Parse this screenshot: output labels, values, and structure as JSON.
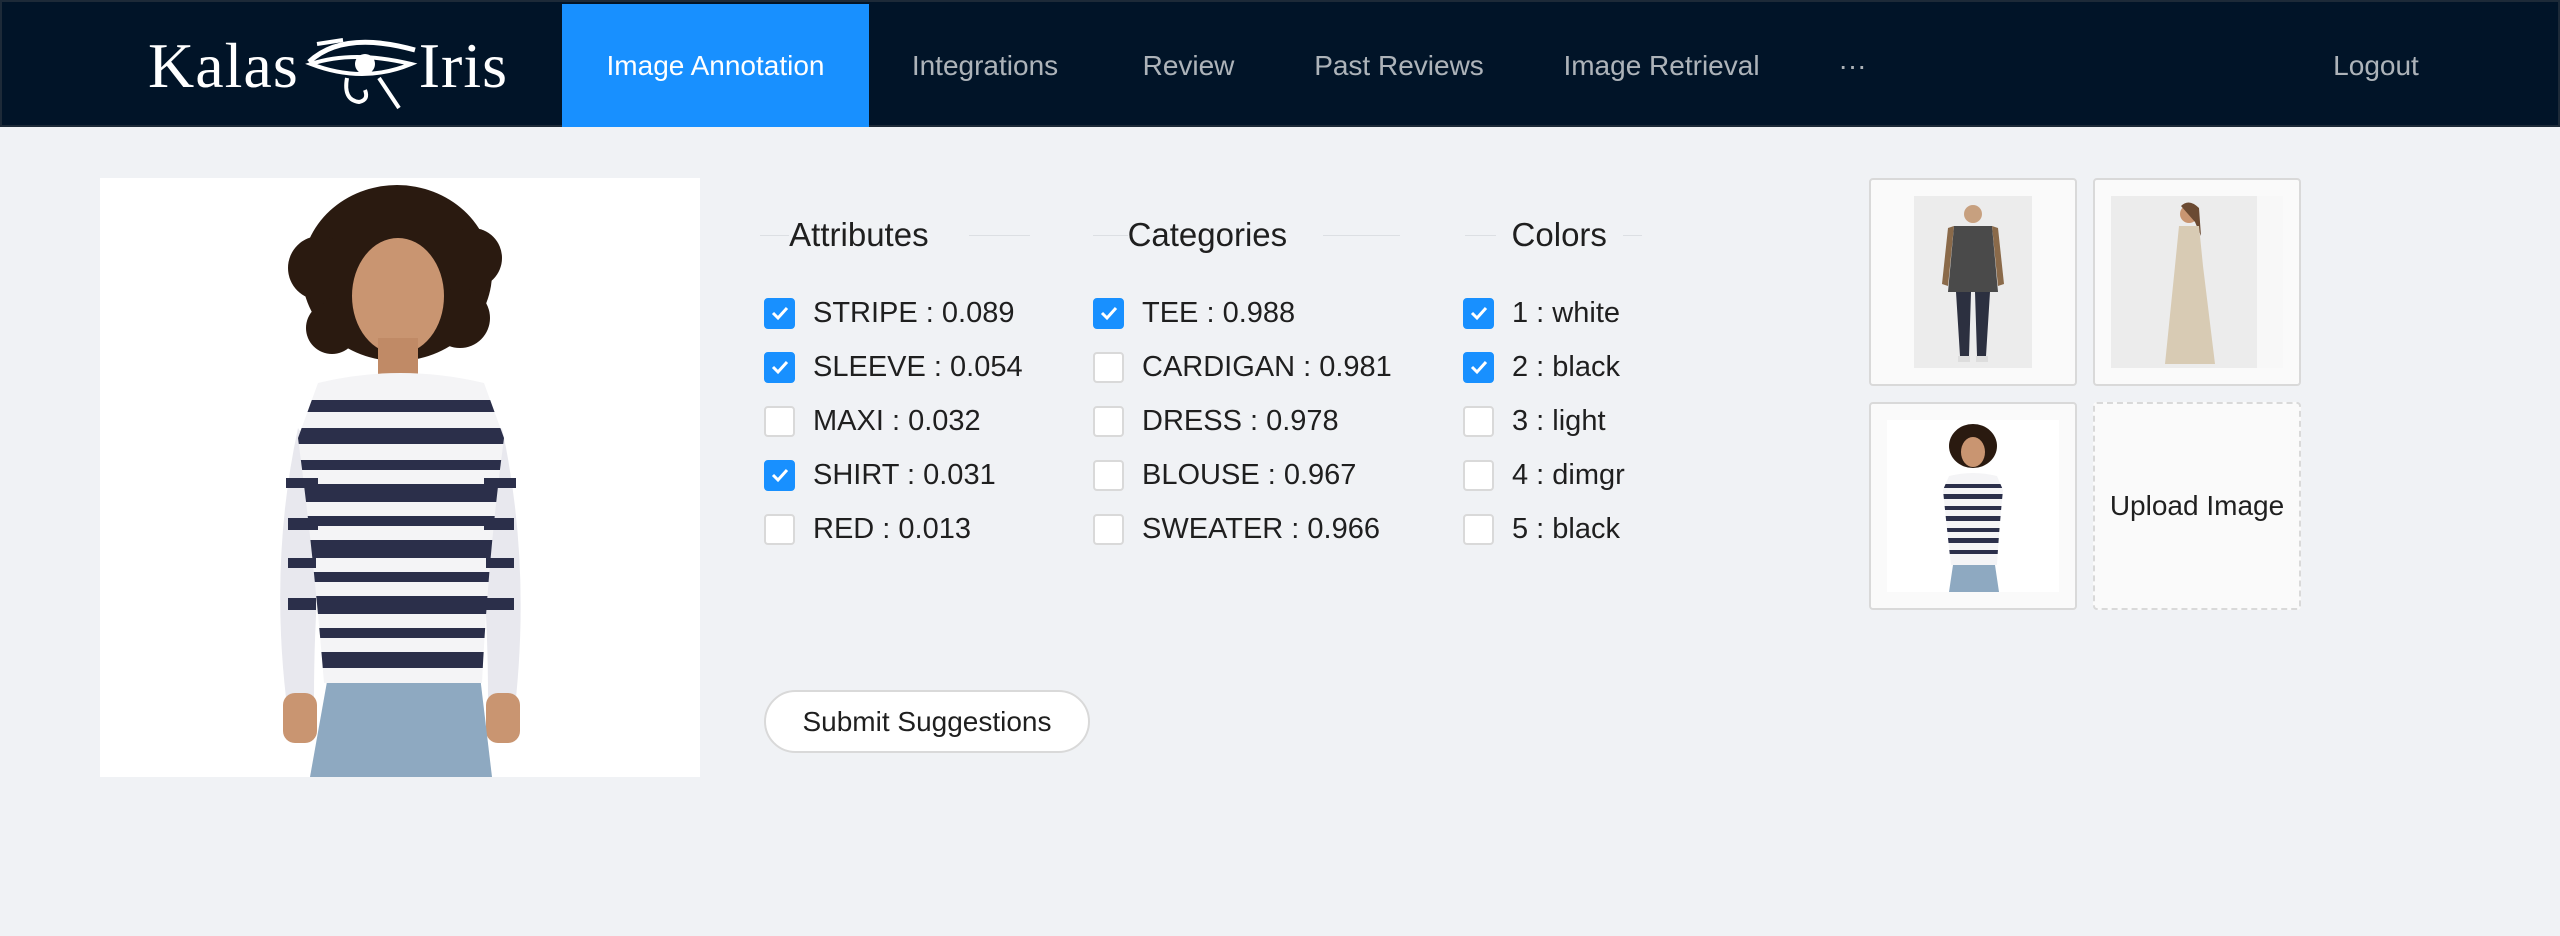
{
  "brand": {
    "part1": "Kalas",
    "part2": "Iris"
  },
  "nav": {
    "items": [
      "Image Annotation",
      "Integrations",
      "Review",
      "Past Reviews",
      "Image Retrieval",
      "···"
    ],
    "active": "Image Annotation",
    "logout": "Logout"
  },
  "colors": {
    "header_bg": "#011428",
    "accent": "#1890ff",
    "page_bg": "#f0f2f5"
  },
  "attributes": {
    "title": "Attributes",
    "items": [
      {
        "label": "STRIPE : 0.089",
        "checked": true
      },
      {
        "label": "SLEEVE : 0.054",
        "checked": true
      },
      {
        "label": "MAXI : 0.032",
        "checked": false
      },
      {
        "label": "SHIRT : 0.031",
        "checked": true
      },
      {
        "label": "RED : 0.013",
        "checked": false
      }
    ]
  },
  "categories": {
    "title": "Categories",
    "items": [
      {
        "label": "TEE : 0.988",
        "checked": true
      },
      {
        "label": "CARDIGAN : 0.981",
        "checked": false
      },
      {
        "label": "DRESS : 0.978",
        "checked": false
      },
      {
        "label": "BLOUSE : 0.967",
        "checked": false
      },
      {
        "label": "SWEATER : 0.966",
        "checked": false
      }
    ]
  },
  "colors_panel": {
    "title": "Colors",
    "items": [
      {
        "label": "1 : white",
        "checked": true
      },
      {
        "label": "2 : black",
        "checked": true
      },
      {
        "label": "3 : light",
        "checked": false
      },
      {
        "label": "4 : dimgr",
        "checked": false
      },
      {
        "label": "5 : black",
        "checked": false
      }
    ]
  },
  "submit_label": "Submit Suggestions",
  "upload_label": "Upload Image"
}
